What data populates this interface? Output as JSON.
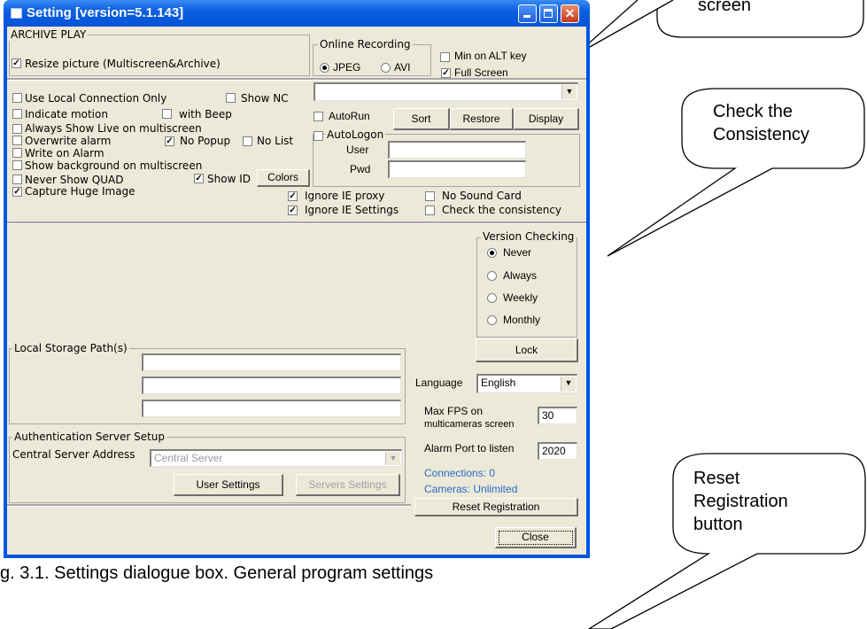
{
  "window": {
    "title": "Setting [version=5.1.143]"
  },
  "archive_play": {
    "label": "ARCHIVE PLAY",
    "resize_picture": {
      "label": "Resize picture (Multiscreen&Archive)",
      "checked": true
    }
  },
  "online_recording": {
    "label": "Online Recording",
    "jpeg": {
      "label": "JPEG",
      "selected": true
    },
    "avi": {
      "label": "AVI",
      "selected": false
    }
  },
  "min_on_alt": {
    "label": "Min on ALT key",
    "checked": false
  },
  "full_screen": {
    "label": "Full Screen",
    "checked": true
  },
  "options": {
    "use_local_connection": {
      "label": "Use Local Connection Only",
      "checked": false
    },
    "show_nc": {
      "label": "Show NC",
      "checked": false
    },
    "indicate_motion": {
      "label": "Indicate motion",
      "checked": false
    },
    "with_beep": {
      "label": "with Beep",
      "checked": false
    },
    "always_show_live": {
      "label": "Always Show Live on multiscreen",
      "checked": false
    },
    "overwrite_alarm": {
      "label": "Overwrite alarm",
      "checked": false
    },
    "no_popup": {
      "label": "No Popup",
      "checked": true
    },
    "no_list": {
      "label": "No List",
      "checked": false
    },
    "write_on_alarm": {
      "label": "Write on Alarm",
      "checked": false
    },
    "show_background": {
      "label": "Show background on multiscreen",
      "checked": false
    },
    "never_show_quad": {
      "label": "Never Show QUAD",
      "checked": false
    },
    "show_id": {
      "label": "Show ID",
      "checked": true
    },
    "capture_huge_image": {
      "label": "Capture Huge Image",
      "checked": true
    }
  },
  "colors_button": "Colors",
  "top_dropdown": {
    "value": ""
  },
  "autorun": {
    "label": "AutoRun",
    "checked": false
  },
  "sort_button": "Sort",
  "restore_button": "Restore",
  "display_button": "Display",
  "autologon": {
    "label": "AutoLogon",
    "checked": false,
    "user_label": "User",
    "user_value": "",
    "pwd_label": "Pwd",
    "pwd_value": ""
  },
  "ignore_ie_proxy": {
    "label": "Ignore IE proxy",
    "checked": true
  },
  "ignore_ie_settings": {
    "label": "Ignore IE Settings",
    "checked": true
  },
  "no_sound_card": {
    "label": "No Sound Card",
    "checked": false
  },
  "check_consistency": {
    "label": "Check the consistency",
    "checked": false
  },
  "version_checking": {
    "label": "Version Checking",
    "options": [
      {
        "label": "Never",
        "selected": true
      },
      {
        "label": "Always",
        "selected": false
      },
      {
        "label": "Weekly",
        "selected": false
      },
      {
        "label": "Monthly",
        "selected": false
      }
    ]
  },
  "lock_button": "Lock",
  "local_storage": {
    "label": "Local Storage Path(s)",
    "paths": [
      "",
      "",
      ""
    ]
  },
  "language": {
    "label": "Language",
    "value": "English"
  },
  "max_fps": {
    "label_line1": "Max FPS on",
    "label_line2": "multicameras screen",
    "value": "30"
  },
  "alarm_port": {
    "label": "Alarm Port to listen",
    "value": "2020"
  },
  "auth_server": {
    "label": "Authentication Server Setup",
    "central_label": "Central Server Address",
    "central_value": "Central Server",
    "user_settings_button": "User Settings",
    "servers_settings_button": "Servers Settings"
  },
  "status": {
    "connections": "Connections: 0",
    "cameras": "Cameras: Unlimited",
    "color": "#2a6acb"
  },
  "reset_registration_button": "Reset Registration",
  "close_button": "Close",
  "caption": "g. 3.1. Settings dialogue box.  General program settings",
  "callouts": {
    "screen": "screen",
    "consistency_line1": "Check the",
    "consistency_line2": "Consistency",
    "reset_line1": "Reset",
    "reset_line2": "Registration",
    "reset_line3": "button"
  }
}
